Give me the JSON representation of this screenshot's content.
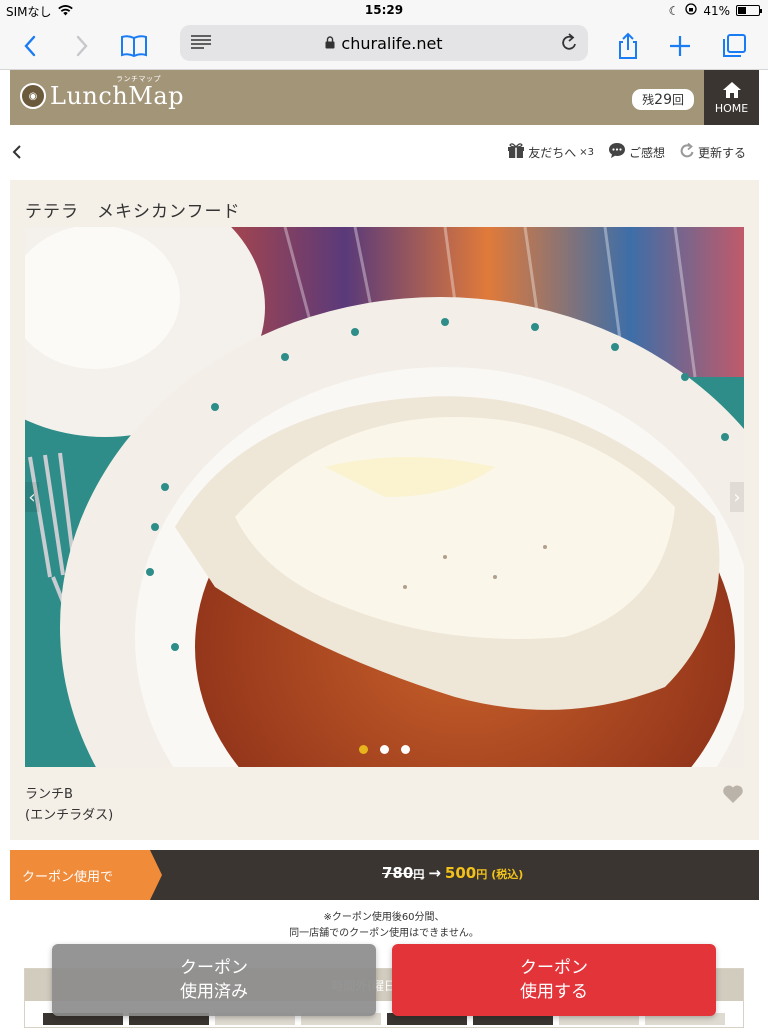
{
  "status_bar": {
    "carrier": "SIMなし",
    "time": "15:29",
    "battery": "41%",
    "battery_level": 0.41
  },
  "browser": {
    "url": "churalife.net"
  },
  "header": {
    "logo_text": "LunchMap",
    "logo_ruby": "ランチマップ",
    "remaining_prefix": "残",
    "remaining_count": "29",
    "remaining_suffix": "回",
    "home_label": "HOME"
  },
  "actions": {
    "friends_label": "友だちへ",
    "friends_count": "×3",
    "review_label": "ご感想",
    "refresh_label": "更新する"
  },
  "card": {
    "title": "テテラ　メキシカンフード",
    "menu_name_line1": "ランチB",
    "menu_name_line2": "(エンチラダス)",
    "slide_count": 3,
    "active_slide": 1
  },
  "coupon": {
    "tag_label": "クーポン使用で",
    "old_price": "780",
    "old_unit": "円",
    "arrow": "→",
    "new_price": "500",
    "new_unit": "円",
    "tax_label": "(税込)"
  },
  "notes": {
    "line1": "※クーポン使用後60分間、",
    "line2": "同一店舗でのクーポン使用はできません。"
  },
  "schedule": {
    "header_label": "時間外(曜日・時間)"
  },
  "buttons": {
    "used_line1": "クーポン",
    "used_line2": "使用済み",
    "use_line1": "クーポン",
    "use_line2": "使用する"
  },
  "colors": {
    "header_bg": "#a39578",
    "card_bg": "#f4efe7",
    "coupon_orange": "#f08b3a",
    "price_yellow": "#f2c21a",
    "use_red": "#e3343a",
    "ios_blue": "#1a7cf5"
  },
  "icons": [
    "wifi-icon",
    "moon-icon",
    "rotation-lock-icon",
    "back-icon",
    "forward-icon",
    "bookmarks-icon",
    "reader-icon",
    "lock-icon",
    "reload-icon",
    "share-icon",
    "new-tab-icon",
    "tabs-icon",
    "home-icon",
    "gift-icon",
    "chat-icon",
    "refresh-icon",
    "heart-icon",
    "chevron-left-icon",
    "chevron-right-icon"
  ]
}
